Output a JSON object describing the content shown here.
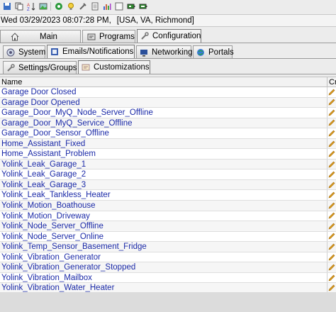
{
  "toolbar": {
    "icons": [
      "save-icon",
      "copy-icon",
      "sort-icon",
      "image-icon",
      "network-icon",
      "bulb-icon",
      "tools-icon",
      "document-icon",
      "chart-icon",
      "window-icon",
      "battery-icon",
      "battery-icon"
    ]
  },
  "status": {
    "datetime": "Wed 03/29/2023 08:07:28 PM,",
    "location": "[USA, VA, Richmond]"
  },
  "tabs_main": [
    {
      "label": "Main"
    },
    {
      "label": "Programs"
    },
    {
      "label": "Configuration"
    }
  ],
  "tabs_config": [
    {
      "label": "System"
    },
    {
      "label": "Emails/Notifications"
    },
    {
      "label": "Networking"
    },
    {
      "label": "Portals"
    }
  ],
  "tabs_notifications": [
    {
      "label": "Settings/Groups"
    },
    {
      "label": "Customizations"
    }
  ],
  "table": {
    "col_name": "Name",
    "col_extra": "Cr",
    "rows": [
      "Garage Door Closed",
      "Garage Door Opened",
      "Garage_Door_MyQ_Node_Server_Offline",
      "Garage_Door_MyQ_Service_Offline",
      "Garage_Door_Sensor_Offline",
      "Home_Assistant_Fixed",
      "Home_Assistant_Problem",
      "Yolink_Leak_Garage_1",
      "Yolink_Leak_Garage_2",
      "Yolink_Leak_Garage_3",
      "Yolink_Leak_Tankless_Heater",
      "Yolink_Motion_Boathouse",
      "Yolink_Motion_Driveway",
      "Yolink_Node_Server_Offline",
      "Yolink_Node_Server_Online",
      "Yolink_Temp_Sensor_Basement_Fridge",
      "Yolink_Vibration_Generator",
      "Yolink_Vibration_Generator_Stopped",
      "Yolink_Vibration_Mailbox",
      "Yolink_Vibration_Water_Heater"
    ]
  },
  "colors": {
    "link_blue": "#1b2aa8",
    "edit_icon": "#e0a020"
  }
}
